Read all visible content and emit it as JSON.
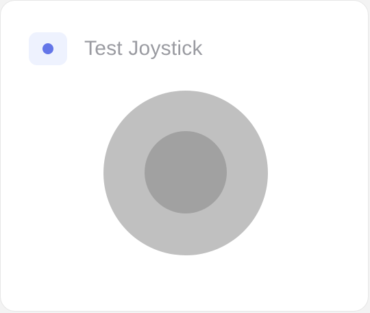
{
  "card": {
    "title": "Test Joystick",
    "icon": "dot-icon"
  },
  "joystick": {
    "knob_position": {
      "x": 0,
      "y": 0
    }
  },
  "colors": {
    "accent": "#6476e8",
    "icon_badge_bg": "#eef2fe",
    "title_text": "#9a9ba1",
    "joystick_base": "#c0c0c0",
    "joystick_knob": "#a1a1a1",
    "card_bg": "#ffffff"
  }
}
